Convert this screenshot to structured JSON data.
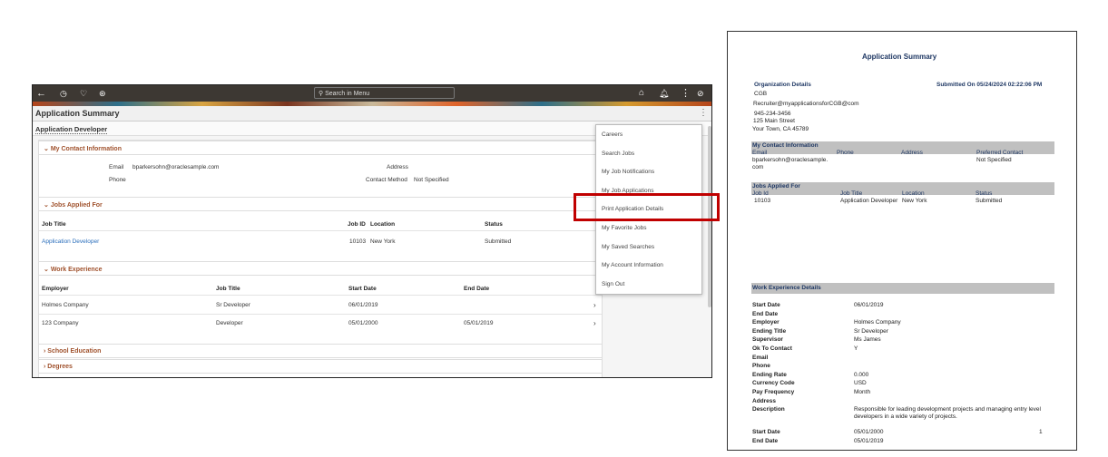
{
  "app": {
    "search_placeholder": "Search in Menu",
    "title": "Application Summary",
    "subtitle": "Application Developer",
    "contact": {
      "heading": "My Contact Information",
      "email_label": "Email",
      "email": "bparkersohn@oraclesample.com",
      "phone_label": "Phone",
      "address_label": "Address",
      "method_label": "Contact Method",
      "method": "Not Specified"
    },
    "jobs": {
      "heading": "Jobs Applied For",
      "headers": [
        "Job Title",
        "Job ID",
        "Location",
        "Status"
      ],
      "rows": [
        {
          "title": "Application Developer",
          "id": "10103",
          "location": "New York",
          "status": "Submitted"
        }
      ]
    },
    "work": {
      "heading": "Work Experience",
      "headers": [
        "Employer",
        "Job Title",
        "Start Date",
        "End Date"
      ],
      "rows": [
        {
          "employer": "Holmes Company",
          "title": "Sr Developer",
          "start": "06/01/2019",
          "end": ""
        },
        {
          "employer": "123 Company",
          "title": "Developer",
          "start": "05/01/2000",
          "end": "05/01/2019"
        }
      ]
    },
    "school": "School Education",
    "degrees": "Degrees",
    "menu": [
      "Careers",
      "Search Jobs",
      "My Job Notifications",
      "My Job Applications",
      "Print Application Details",
      "My Favorite Jobs",
      "My Saved Searches",
      "My Account Information",
      "Sign Out"
    ]
  },
  "doc": {
    "title": "Application Summary",
    "org_heading": "Organization Details",
    "submitted": "Submitted On 05/24/2024 02:22:06 PM",
    "org": [
      "CGB",
      "Recruiter@myapplicationsforCGB@com",
      "945-234-3456",
      "125 Main Street",
      "Your Town, CA 45789"
    ],
    "contact": {
      "heading": "My Contact Information",
      "headers": [
        "Email",
        "Phone",
        "Address",
        "Preferred Contact"
      ],
      "email1": "bparkersohn@oraclesample.",
      "email2": "com",
      "preferred": "Not Specified"
    },
    "jobs": {
      "heading": "Jobs Applied For",
      "headers": [
        "Job Id",
        "Job Title",
        "Location",
        "Status"
      ],
      "row": [
        "10103",
        "Application Developer",
        "New York",
        "Submitted"
      ]
    },
    "work": {
      "heading": "Work Experience Details",
      "rows": [
        [
          "Start Date",
          "06/01/2019"
        ],
        [
          "End Date",
          ""
        ],
        [
          "Employer",
          "Holmes Company"
        ],
        [
          "Ending Title",
          "Sr Developer"
        ],
        [
          "Supervisor",
          "Ms James"
        ],
        [
          "Ok To Contact",
          "Y"
        ],
        [
          "Email",
          ""
        ],
        [
          "Phone",
          ""
        ],
        [
          "Ending Rate",
          "0.000"
        ],
        [
          "Currency Code",
          "USD"
        ],
        [
          "Pay Frequency",
          "Month"
        ],
        [
          "Address",
          ""
        ],
        [
          "Description",
          "Responsible for leading development projects and managing entry level"
        ]
      ],
      "desc2": "developers in a wide variety of projects.",
      "rows2": [
        [
          "Start Date",
          "05/01/2000"
        ],
        [
          "End Date",
          "05/01/2019"
        ]
      ],
      "page": "1"
    }
  }
}
